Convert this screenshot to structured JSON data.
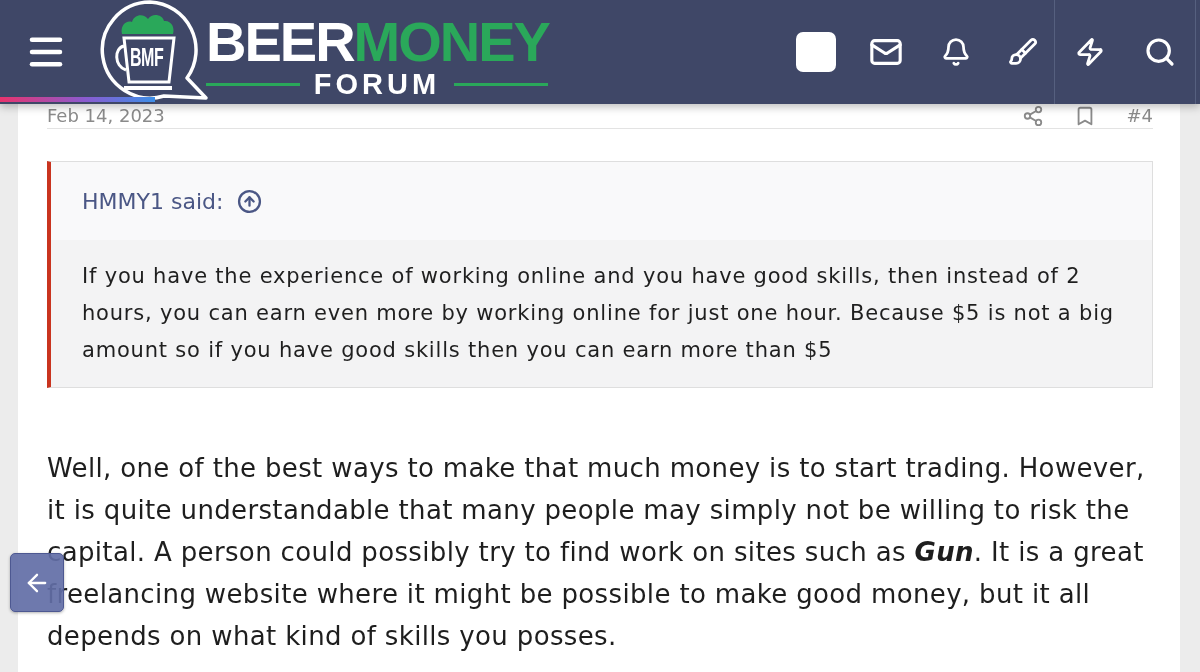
{
  "header": {
    "logo": {
      "monogram": "BMF",
      "title_1": "BEER",
      "title_2": "MONEY",
      "subtitle": "FORUM"
    }
  },
  "post": {
    "date": "Feb 14, 2023",
    "number": "#4",
    "quote": {
      "author_line": "HMMY1 said:",
      "text": "If you have the experience of working online and you have good skills, then instead of 2 hours, you can earn even more by working online for just one hour. Because $5 is not a big amount so if you have good skills then you can earn more than $5"
    },
    "body": "Well, one of the best ways to make that much money is to start trading. However, it is quite understandable that many people may simply not be willing to risk the capital. A person could possibly try to find work on sites such as **Gun**. It is a great freelancing website where it might be possible to make good money, but it all depends on what kind of skills you posses."
  }
}
